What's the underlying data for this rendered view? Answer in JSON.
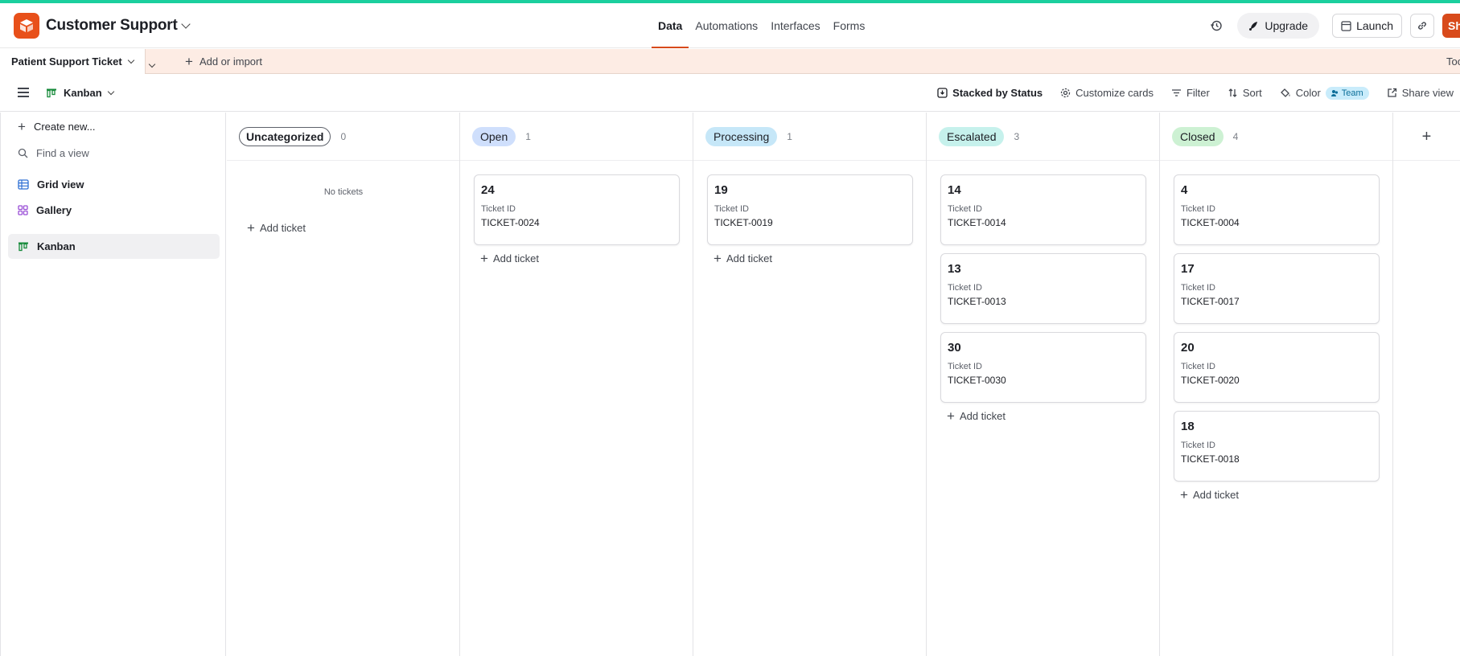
{
  "base": {
    "title": "Customer Support"
  },
  "nav": {
    "tabs": [
      "Data",
      "Automations",
      "Interfaces",
      "Forms"
    ],
    "active": "Data"
  },
  "header_actions": {
    "upgrade": "Upgrade",
    "launch": "Launch",
    "share_cut": "Sh"
  },
  "tables": {
    "current": "Patient Support Ticket",
    "add_import": "Add or import",
    "tools_cut": "Too"
  },
  "view": {
    "name": "Kanban",
    "stacked_by": "Stacked by Status",
    "customize_cards": "Customize cards",
    "filter": "Filter",
    "sort": "Sort",
    "color": "Color",
    "color_badge": "Team",
    "share_view": "Share view"
  },
  "sidebar": {
    "create_new": "Create new...",
    "find_view": "Find a view",
    "views": [
      {
        "label": "Grid view",
        "icon": "grid-icon"
      },
      {
        "label": "Gallery",
        "icon": "gallery-icon"
      },
      {
        "label": "Kanban",
        "icon": "kanban-icon",
        "selected": true
      }
    ]
  },
  "board": {
    "add_ticket_label": "Add ticket",
    "field_label": "Ticket ID",
    "stacks": [
      {
        "name": "Uncategorized",
        "count": "0",
        "style": "outline",
        "empty_text": "No tickets",
        "cards": []
      },
      {
        "name": "Open",
        "count": "1",
        "color": "#cfdffc",
        "cards": [
          {
            "title": "24",
            "ticket_id": "TICKET-0024"
          }
        ]
      },
      {
        "name": "Processing",
        "count": "1",
        "color": "#c6e7f8",
        "cards": [
          {
            "title": "19",
            "ticket_id": "TICKET-0019"
          }
        ]
      },
      {
        "name": "Escalated",
        "count": "3",
        "color": "#c6f1ec",
        "cards": [
          {
            "title": "14",
            "ticket_id": "TICKET-0014"
          },
          {
            "title": "13",
            "ticket_id": "TICKET-0013"
          },
          {
            "title": "30",
            "ticket_id": "TICKET-0030"
          }
        ]
      },
      {
        "name": "Closed",
        "count": "4",
        "color": "#cdf1d3",
        "cards": [
          {
            "title": "4",
            "ticket_id": "TICKET-0004"
          },
          {
            "title": "17",
            "ticket_id": "TICKET-0017"
          },
          {
            "title": "20",
            "ticket_id": "TICKET-0020"
          },
          {
            "title": "18",
            "ticket_id": "TICKET-0018"
          }
        ]
      }
    ]
  },
  "colors": {
    "brand": "#e8501a",
    "accent_line": "#1bcf9e",
    "tab_bar_bg": "#fdece4"
  }
}
